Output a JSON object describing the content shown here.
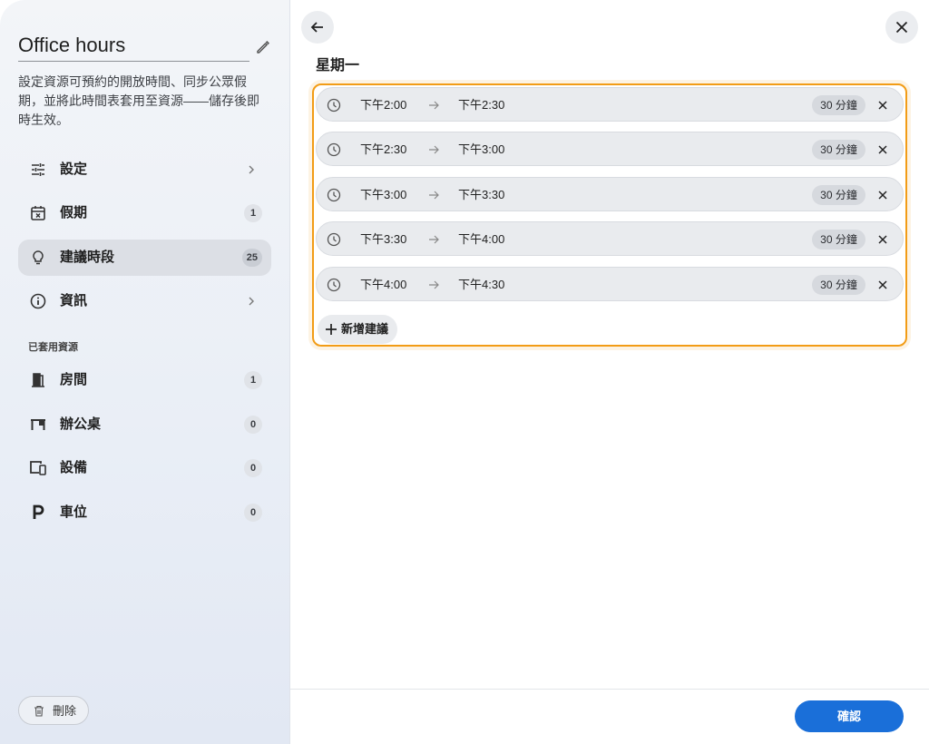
{
  "sidebar": {
    "title": "Office hours",
    "description": "設定資源可預約的開放時間、同步公眾假期，並將此時間表套用至資源——儲存後即時生效。",
    "nav": [
      {
        "label": "設定",
        "icon": "sliders-icon",
        "trailing": "chevron"
      },
      {
        "label": "假期",
        "icon": "calendar-x-icon",
        "badge": "1"
      },
      {
        "label": "建議時段",
        "icon": "lightbulb-icon",
        "badge": "25",
        "active": true
      },
      {
        "label": "資訊",
        "icon": "info-icon",
        "trailing": "chevron"
      }
    ],
    "section_label": "已套用資源",
    "resources": [
      {
        "label": "房間",
        "icon": "door-icon",
        "badge": "1"
      },
      {
        "label": "辦公桌",
        "icon": "desk-icon",
        "badge": "0"
      },
      {
        "label": "設備",
        "icon": "devices-icon",
        "badge": "0"
      },
      {
        "label": "車位",
        "icon": "parking-icon",
        "badge": "0"
      }
    ],
    "delete_label": "刪除"
  },
  "main": {
    "day_title": "星期一",
    "slots": [
      {
        "start": "下午2:00",
        "end": "下午2:30",
        "duration": "30 分鐘"
      },
      {
        "start": "下午2:30",
        "end": "下午3:00",
        "duration": "30 分鐘"
      },
      {
        "start": "下午3:00",
        "end": "下午3:30",
        "duration": "30 分鐘"
      },
      {
        "start": "下午3:30",
        "end": "下午4:00",
        "duration": "30 分鐘"
      },
      {
        "start": "下午4:00",
        "end": "下午4:30",
        "duration": "30 分鐘"
      }
    ],
    "add_label": "新增建議",
    "confirm_label": "確認"
  },
  "colors": {
    "accent": "#1a6fd9",
    "highlight_border": "#f29c16"
  }
}
